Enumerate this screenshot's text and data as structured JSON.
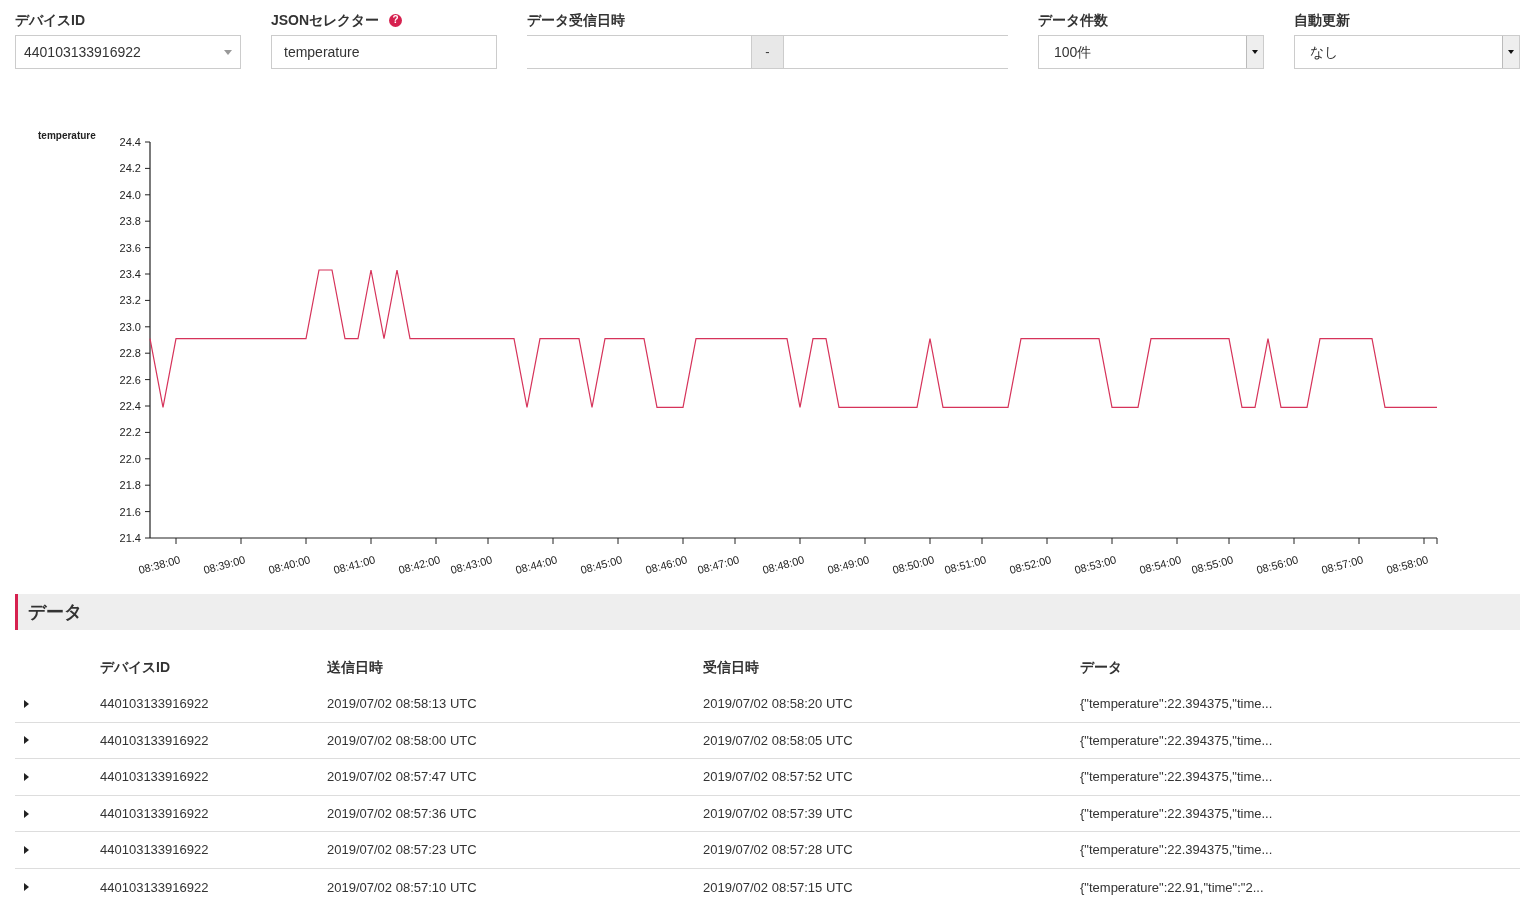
{
  "filters": [
    {
      "kind": "select",
      "label": "デバイスID",
      "value": "440103133916922"
    },
    {
      "kind": "text",
      "label": "JSONセレクター",
      "help": "?",
      "value": "temperature"
    },
    {
      "kind": "range",
      "label": "データ受信日時",
      "separator": "-"
    },
    {
      "kind": "dropdown",
      "label": "データ件数",
      "value": "100件"
    },
    {
      "kind": "dropdown",
      "label": "自動更新",
      "value": "なし"
    }
  ],
  "chart_data": {
    "type": "line",
    "ylabel": "temperature",
    "categories": [
      null,
      null,
      "08:38:00",
      null,
      null,
      null,
      null,
      "08:39:00",
      null,
      null,
      null,
      null,
      "08:40:00",
      null,
      null,
      null,
      null,
      "08:41:00",
      null,
      null,
      null,
      null,
      "08:42:00",
      null,
      null,
      null,
      "08:43:00",
      null,
      null,
      null,
      null,
      "08:44:00",
      null,
      null,
      null,
      null,
      "08:45:00",
      null,
      null,
      null,
      null,
      "08:46:00",
      null,
      null,
      null,
      "08:47:00",
      null,
      null,
      null,
      null,
      "08:48:00",
      null,
      null,
      null,
      null,
      "08:49:00",
      null,
      null,
      null,
      null,
      "08:50:00",
      null,
      null,
      null,
      "08:51:00",
      null,
      null,
      null,
      null,
      "08:52:00",
      null,
      null,
      null,
      null,
      "08:53:00",
      null,
      null,
      null,
      null,
      "08:54:00",
      null,
      null,
      null,
      "08:55:00",
      null,
      null,
      null,
      null,
      "08:56:00",
      null,
      null,
      null,
      null,
      "08:57:00",
      null,
      null,
      null,
      null,
      "08:58:00",
      null
    ],
    "series": [
      {
        "color": "#d6335a",
        "values": [
          22.91,
          22.39,
          22.91,
          22.91,
          22.91,
          22.91,
          22.91,
          22.91,
          22.91,
          22.91,
          22.91,
          22.91,
          22.91,
          23.43,
          23.43,
          22.91,
          22.91,
          23.43,
          22.91,
          23.43,
          22.91,
          22.91,
          22.91,
          22.91,
          22.91,
          22.91,
          22.91,
          22.91,
          22.91,
          22.39,
          22.91,
          22.91,
          22.91,
          22.91,
          22.39,
          22.91,
          22.91,
          22.91,
          22.91,
          22.39,
          22.39,
          22.39,
          22.91,
          22.91,
          22.91,
          22.91,
          22.91,
          22.91,
          22.91,
          22.91,
          22.39,
          22.91,
          22.91,
          22.39,
          22.39,
          22.39,
          22.39,
          22.39,
          22.39,
          22.39,
          22.91,
          22.39,
          22.39,
          22.39,
          22.39,
          22.39,
          22.39,
          22.91,
          22.91,
          22.91,
          22.91,
          22.91,
          22.91,
          22.91,
          22.39,
          22.39,
          22.39,
          22.91,
          22.91,
          22.91,
          22.91,
          22.91,
          22.91,
          22.91,
          22.39,
          22.39,
          22.91,
          22.39,
          22.39,
          22.39,
          22.91,
          22.91,
          22.91,
          22.91,
          22.91,
          22.39,
          22.39,
          22.39,
          22.39,
          22.39
        ]
      }
    ],
    "ylim": [
      21.4,
      24.4
    ],
    "yticks": [
      21.4,
      21.6,
      21.8,
      {
        "value": 22,
        "label": "22.0"
      },
      22.2,
      22.4,
      22.6,
      22.8,
      {
        "value": 23,
        "label": "23.0"
      },
      23.2,
      23.4,
      23.6,
      23.8,
      {
        "value": 24,
        "label": "24.0"
      },
      24.2,
      24.4
    ]
  },
  "section": {
    "title": "データ"
  },
  "table": {
    "columns": [
      "デバイスID",
      "送信日時",
      "受信日時",
      "データ"
    ],
    "rows": [
      {
        "expanded": false,
        "cells": [
          "440103133916922",
          "2019/07/02 08:58:13 UTC",
          "2019/07/02 08:58:20 UTC",
          "{\"temperature\":22.394375,\"time..."
        ]
      },
      {
        "expanded": false,
        "cells": [
          "440103133916922",
          "2019/07/02 08:58:00 UTC",
          "2019/07/02 08:58:05 UTC",
          "{\"temperature\":22.394375,\"time..."
        ]
      },
      {
        "expanded": false,
        "cells": [
          "440103133916922",
          "2019/07/02 08:57:47 UTC",
          "2019/07/02 08:57:52 UTC",
          "{\"temperature\":22.394375,\"time..."
        ]
      },
      {
        "expanded": false,
        "cells": [
          "440103133916922",
          "2019/07/02 08:57:36 UTC",
          "2019/07/02 08:57:39 UTC",
          "{\"temperature\":22.394375,\"time..."
        ]
      },
      {
        "expanded": false,
        "cells": [
          "440103133916922",
          "2019/07/02 08:57:23 UTC",
          "2019/07/02 08:57:28 UTC",
          "{\"temperature\":22.394375,\"time..."
        ]
      },
      {
        "expanded": false,
        "cells": [
          "440103133916922",
          "2019/07/02 08:57:10 UTC",
          "2019/07/02 08:57:15 UTC",
          "{\"temperature\":22.91,\"time\":\"2..."
        ]
      }
    ]
  }
}
